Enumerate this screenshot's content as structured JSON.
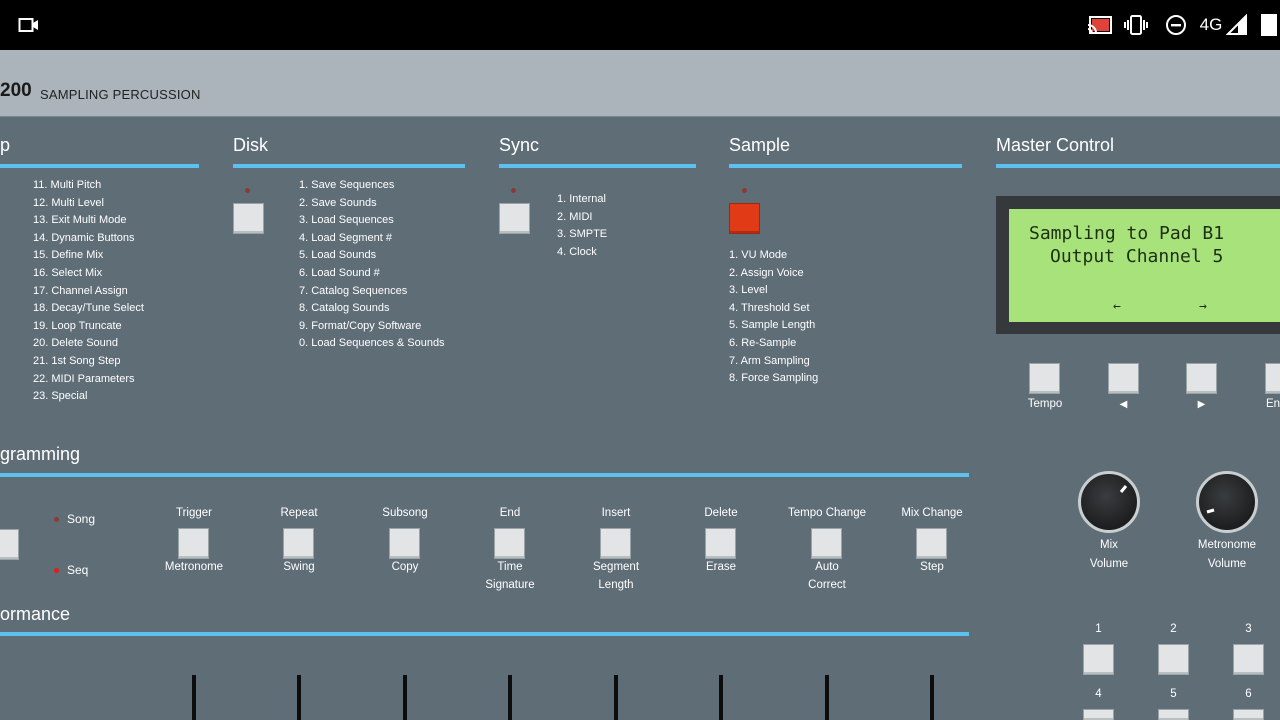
{
  "status_bar": {
    "network": "4G",
    "icons": [
      "video-camera-icon",
      "cast-icon",
      "vibrate-icon",
      "do-not-disturb-icon",
      "signal-icon",
      "battery-icon"
    ]
  },
  "header": {
    "model_number": "200",
    "model_subtitle": "SAMPLING PERCUSSION"
  },
  "setup": {
    "title": "p",
    "items": [
      "11. Multi Pitch",
      "12. Multi Level",
      "13. Exit Multi Mode",
      "14. Dynamic Buttons",
      "15. Define Mix",
      "16. Select Mix",
      "17. Channel Assign",
      "18. Decay/Tune Select",
      "19. Loop Truncate",
      "20. Delete Sound",
      "21. 1st Song Step",
      "22. MIDI Parameters",
      "23. Special"
    ]
  },
  "disk": {
    "title": "Disk",
    "items": [
      "1. Save Sequences",
      "2. Save Sounds",
      "3. Load Sequences",
      "4. Load Segment #",
      "5. Load Sounds",
      "6. Load Sound #",
      "7. Catalog Sequences",
      "8. Catalog Sounds",
      "9. Format/Copy Software",
      "0. Load Sequences & Sounds"
    ]
  },
  "sync": {
    "title": "Sync",
    "items": [
      "1. Internal",
      "2. MIDI",
      "3. SMPTE",
      "4. Clock"
    ]
  },
  "sample": {
    "title": "Sample",
    "items": [
      "1. VU Mode",
      "2. Assign Voice",
      "3. Level",
      "4. Threshold Set",
      "5. Sample Length",
      "6. Re-Sample",
      "7. Arm Sampling",
      "8. Force Sampling"
    ]
  },
  "master": {
    "title": "Master Control",
    "lcd_line1": "Sampling to Pad B1",
    "lcd_line2": "Output Channel 5",
    "lcd_left": "←",
    "lcd_right": "→",
    "buttons": [
      "Tempo",
      "◀",
      "▶",
      "En"
    ],
    "mix_volume": "Mix\nVolume",
    "metronome_volume": "Metronome\nVolume",
    "mix_volume_l1": "Mix",
    "mix_volume_l2": "Volume",
    "metronome_volume_l1": "Metronome",
    "metronome_volume_l2": "Volume",
    "pads": [
      "1",
      "2",
      "3",
      "4",
      "5",
      "6"
    ]
  },
  "programming": {
    "title": "gramming",
    "song": "Song",
    "seq": "Seq",
    "buttons": [
      {
        "top": "Trigger",
        "bottom": "Metronome"
      },
      {
        "top": "Repeat",
        "bottom": "Swing"
      },
      {
        "top": "Subsong",
        "bottom": "Copy"
      },
      {
        "top": "End",
        "bottom": "Time\nSignature",
        "b1": "Time",
        "b2": "Signature"
      },
      {
        "top": "Insert",
        "bottom": "Segment\nLength",
        "b1": "Segment",
        "b2": "Length"
      },
      {
        "top": "Delete",
        "bottom": "Erase"
      },
      {
        "top": "Tempo Change",
        "bottom": "Auto\nCorrect",
        "b1": "Auto",
        "b2": "Correct"
      },
      {
        "top": "Mix Change",
        "bottom": "Step"
      }
    ]
  },
  "performance": {
    "title": "ormance"
  },
  "colors": {
    "panel": "#5f6d77",
    "accent_line": "#5ec0ee",
    "lcd": "#a8e27a",
    "record_button": "#e03a16"
  }
}
